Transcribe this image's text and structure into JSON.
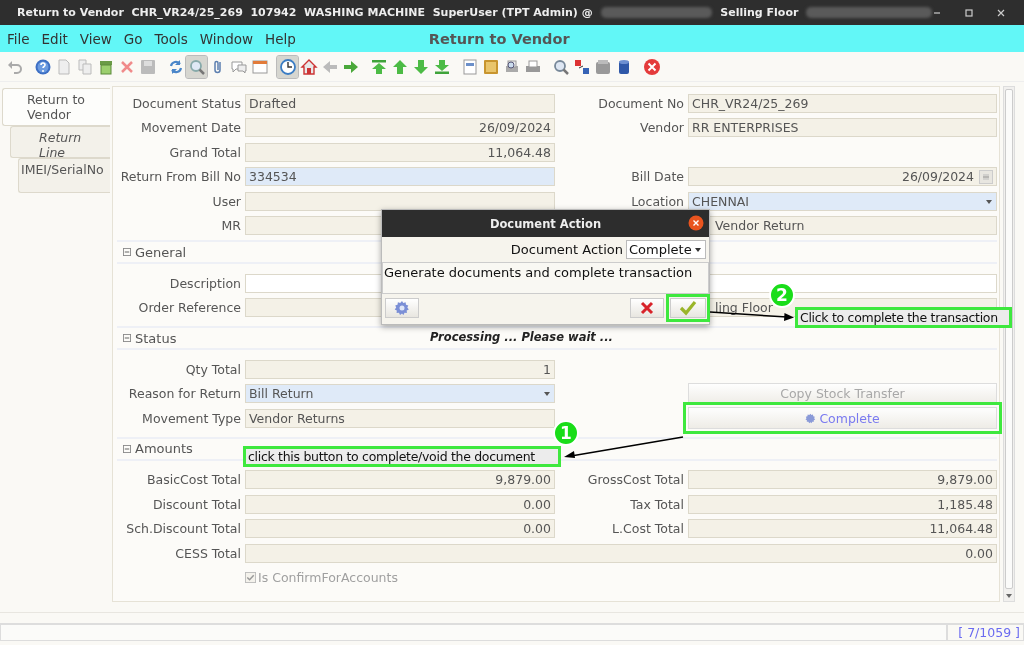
{
  "window": {
    "title": "Return to Vendor  CHR_VR24/25_269  107942  WASHING MACHINE  SuperUser (TPT Admin) @",
    "location": "Selling Floor"
  },
  "menu": [
    {
      "label": "File"
    },
    {
      "label": "Edit"
    },
    {
      "label": "View"
    },
    {
      "label": "Go"
    },
    {
      "label": "Tools"
    },
    {
      "label": "Window"
    },
    {
      "label": "Help"
    }
  ],
  "header_title": "Return to Vendor",
  "tabs": [
    {
      "label": "Return to Vendor",
      "selected": true,
      "children": [
        {
          "label": "Return Line",
          "selected": false,
          "italic": true,
          "children": [
            {
              "label": "IMEI/SerialNo",
              "selected": false
            }
          ]
        }
      ]
    }
  ],
  "sections": [
    {
      "rows": [
        [
          {
            "label": "Document Status",
            "value": "Drafted",
            "kind": "text"
          },
          {
            "label": "Document No",
            "value": "CHR_VR24/25_269",
            "kind": "text"
          }
        ],
        [
          {
            "label": "Movement Date",
            "value": "26/09/2024",
            "kind": "number"
          },
          {
            "label": "Vendor",
            "value": "RR ENTERPRISES",
            "kind": "text"
          }
        ],
        [
          {
            "label": "Grand Total",
            "value": "11,064.48",
            "kind": "number"
          }
        ],
        [
          {
            "label": "Return From Bill No",
            "value": "334534",
            "kind": "lookup"
          },
          {
            "label": "Bill Date",
            "value": "26/09/2024",
            "kind": "date"
          }
        ],
        [
          {
            "label": "User",
            "kind": "text"
          },
          {
            "label": "Location",
            "value": "CHENNAI",
            "kind": "combo"
          }
        ],
        [
          {
            "label": "MR",
            "kind": "text"
          },
          {
            "value": "Vendor Return",
            "kind": "text",
            "clipped": true
          }
        ]
      ]
    },
    {
      "title": "General",
      "rows": [
        [
          {
            "label": "Description",
            "kind": "input",
            "wide": true
          }
        ],
        [
          {
            "label": "Order Reference",
            "kind": "text"
          },
          {
            "value": "ling Floor",
            "kind": "text",
            "clipped": true
          }
        ]
      ]
    },
    {
      "title": "Status",
      "rows": [
        [
          {
            "label": "Qty Total",
            "value": "1",
            "kind": "number"
          }
        ],
        [
          {
            "label": "Reason for Return",
            "value": "Bill Return",
            "kind": "combo"
          },
          {
            "value": "Copy Stock Transfer",
            "kind": "button",
            "disabled": true
          }
        ],
        [
          {
            "label": "Movement Type",
            "value": "Vendor Returns",
            "kind": "text"
          },
          {
            "value": "Complete",
            "kind": "process-button",
            "disabled": false,
            "highlighted": true
          }
        ]
      ]
    },
    {
      "title": "Amounts",
      "rows": [
        [
          {
            "label": "BasicCost Total",
            "value": "9,879.00",
            "kind": "number"
          },
          {
            "label": "GrossCost Total",
            "value": "9,879.00",
            "kind": "number"
          }
        ],
        [
          {
            "label": "Discount Total",
            "value": "0.00",
            "kind": "number"
          },
          {
            "label": "Tax Total",
            "value": "1,185.48",
            "kind": "number"
          }
        ],
        [
          {
            "label": "Sch.Discount Total",
            "value": "0.00",
            "kind": "number"
          },
          {
            "label": "L.Cost Total",
            "value": "11,064.48",
            "kind": "number"
          }
        ],
        [
          {
            "label": "CESS Total",
            "value": "0.00",
            "kind": "number",
            "wide": true
          }
        ],
        [
          {
            "value": "Is ConfirmForAccounts",
            "kind": "checkbox",
            "checked": true,
            "disabled": true
          }
        ]
      ]
    }
  ],
  "processing": "Processing ... Please wait ...",
  "dialog": {
    "title": "Document Action",
    "label": "Document Action",
    "action": "Complete",
    "description": "Generate documents and complete transaction",
    "ok_highlighted": true
  },
  "annotations": [
    {
      "number": "1",
      "text": "click this button to complete/void the document"
    },
    {
      "number": "2",
      "text": "Click to complete the transaction"
    }
  ],
  "status_bar": {
    "record": "[ 7/1059 ]"
  }
}
